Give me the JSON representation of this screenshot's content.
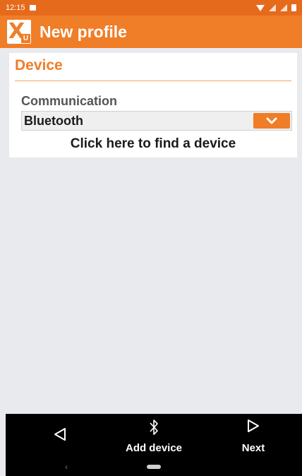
{
  "status_bar": {
    "time": "12:15"
  },
  "app_bar": {
    "title": "New profile",
    "logo_icon": "xu-logo",
    "logo_badge": "U"
  },
  "device_section": {
    "title": "Device",
    "communication_label": "Communication",
    "communication_value": "Bluetooth",
    "find_device_link": "Click here to find a device"
  },
  "bottom_bar": {
    "back_icon": "triangle-left-icon",
    "add_device_label": "Add device",
    "add_device_icon": "bluetooth-icon",
    "next_label": "Next",
    "next_icon": "triangle-right-icon"
  },
  "colors": {
    "accent": "#f07d27",
    "status_bar": "#e66a1c",
    "background": "#e8eaee"
  }
}
